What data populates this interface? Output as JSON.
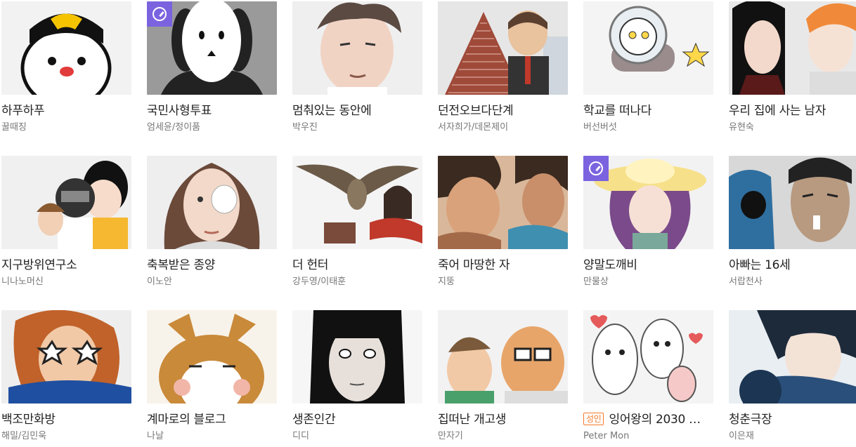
{
  "colors": {
    "clock_badge": "#7b63e0",
    "adult_badge": "#f47a2b",
    "title_text": "#222222",
    "author_text": "#777777"
  },
  "badges": {
    "adult_label": "성인"
  },
  "cards": [
    {
      "title": "하푸하푸",
      "author": "꿀때징",
      "bg": "#f2f2f2",
      "fg": "#111111",
      "accent": "#f5c300",
      "badge_clock": false,
      "adult": false,
      "art": "dog"
    },
    {
      "title": "국민사형투표",
      "author": "엄세윤/정이품",
      "bg": "#9a9a9a",
      "fg": "#ffffff",
      "accent": "#222222",
      "badge_clock": true,
      "adult": false,
      "art": "mask"
    },
    {
      "title": "멈춰있는 동안에",
      "author": "박우진",
      "bg": "#efefef",
      "fg": "#5a4a42",
      "accent": "#f1d3c4",
      "badge_clock": false,
      "adult": false,
      "art": "face"
    },
    {
      "title": "던전오브다단계",
      "author": "서자희가/데몬제이",
      "bg": "#e6e6e6",
      "fg": "#a04a3a",
      "accent": "#5b4030",
      "badge_clock": false,
      "adult": false,
      "art": "pyramid"
    },
    {
      "title": "학교를 떠나다",
      "author": "버선버섯",
      "bg": "#f4f4f4",
      "fg": "#9a8c8c",
      "accent": "#ffd84a",
      "badge_clock": false,
      "adult": false,
      "art": "cat"
    },
    {
      "title": "우리 집에 사는 남자",
      "author": "유현숙",
      "bg": "#e8e8e8",
      "fg": "#111111",
      "accent": "#f08a3a",
      "badge_clock": false,
      "adult": false,
      "art": "couple"
    },
    {
      "title": "지구방위연구소",
      "author": "니나노머신",
      "bg": "#f0f0f0",
      "fg": "#222222",
      "accent": "#f5b830",
      "badge_clock": false,
      "adult": false,
      "art": "trio"
    },
    {
      "title": "축복받은 종양",
      "author": "이노안",
      "bg": "#eeeeee",
      "fg": "#6b4a3a",
      "accent": "#f2d9c9",
      "badge_clock": false,
      "adult": false,
      "art": "girl"
    },
    {
      "title": "더 헌터",
      "author": "강두영/이태훈",
      "bg": "#f4f4f4",
      "fg": "#6b5a48",
      "accent": "#c0392b",
      "badge_clock": false,
      "adult": false,
      "art": "hawk"
    },
    {
      "title": "죽어 마땅한 자",
      "author": "지뚱",
      "bg": "#d9b79a",
      "fg": "#3a2a20",
      "accent": "#3f8fb0",
      "badge_clock": false,
      "adult": false,
      "art": "men"
    },
    {
      "title": "양말도깨비",
      "author": "만물상",
      "bg": "#f2f2f2",
      "fg": "#7a4a8a",
      "accent": "#f6e08a",
      "badge_clock": true,
      "adult": false,
      "art": "hatgirl"
    },
    {
      "title": "아빠는 16세",
      "author": "서랍천사",
      "bg": "#d8d8d8",
      "fg": "#2a3a4a",
      "accent": "#2f6fa0",
      "badge_clock": false,
      "adult": false,
      "art": "dad"
    },
    {
      "title": "백조만화방",
      "author": "해밀/김민욱",
      "bg": "#eeeeee",
      "fg": "#c0622a",
      "accent": "#1f4fa0",
      "badge_clock": false,
      "adult": false,
      "art": "glasses"
    },
    {
      "title": "계마로의 블로그",
      "author": "나날",
      "bg": "#f8f3ea",
      "fg": "#c98a3a",
      "accent": "#f2b6a8",
      "badge_clock": false,
      "adult": false,
      "art": "corgi"
    },
    {
      "title": "생존인간",
      "author": "디디",
      "bg": "#f6f6f6",
      "fg": "#111111",
      "accent": "#e7e0da",
      "badge_clock": false,
      "adult": false,
      "art": "hair"
    },
    {
      "title": "집떠난 개고생",
      "author": "만자기",
      "bg": "#f2f2f2",
      "fg": "#7a5a3a",
      "accent": "#e8a56a",
      "badge_clock": false,
      "adult": false,
      "art": "oldman"
    },
    {
      "title": "잉어왕의 2030 …",
      "author": "Peter Mon",
      "bg": "#f4f4f4",
      "fg": "#555555",
      "accent": "#e55a5a",
      "badge_clock": false,
      "adult": true,
      "art": "doodle"
    },
    {
      "title": "청춘극장",
      "author": "이은재",
      "bg": "#e9eef2",
      "fg": "#1d2a3a",
      "accent": "#2a4f7a",
      "badge_clock": false,
      "adult": false,
      "art": "youth"
    }
  ]
}
